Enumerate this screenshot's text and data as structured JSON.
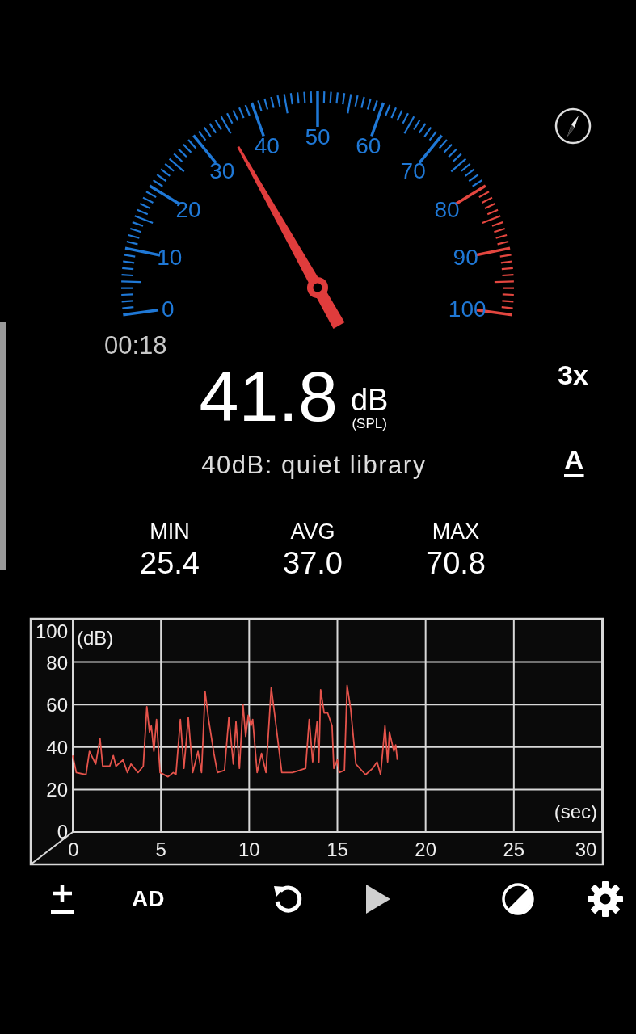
{
  "gauge": {
    "scale_labels": [
      "0",
      "10",
      "20",
      "30",
      "40",
      "50",
      "60",
      "70",
      "80",
      "90",
      "100"
    ],
    "timer": "00:18"
  },
  "reading": {
    "value": "41.8",
    "unit": "dB",
    "unit_note": "(SPL)",
    "zoom": "3x",
    "description": "40dB: quiet library",
    "weighting": "A"
  },
  "stats": [
    {
      "label": "MIN",
      "value": "25.4"
    },
    {
      "label": "AVG",
      "value": "37.0"
    },
    {
      "label": "MAX",
      "value": "70.8"
    }
  ],
  "history": {
    "chart_data": {
      "type": "line",
      "grid": true,
      "xlabel": "(sec)",
      "ylabel": "(dB)",
      "xlim": [
        0,
        30
      ],
      "ylim": [
        0,
        100
      ],
      "xticks": [
        0,
        5,
        10,
        15,
        20,
        25,
        30
      ],
      "yticks": [
        0,
        20,
        40,
        60,
        80,
        100
      ],
      "x": [
        0,
        0.2,
        0.75,
        0.95,
        1.3,
        1.55,
        1.7,
        2.1,
        2.3,
        2.45,
        2.85,
        3.1,
        3.3,
        3.7,
        4.0,
        4.2,
        4.35,
        4.45,
        4.6,
        4.75,
        4.95,
        5.4,
        5.7,
        5.85,
        6.1,
        6.3,
        6.55,
        6.8,
        7.1,
        7.3,
        7.5,
        7.7,
        8.0,
        8.2,
        8.6,
        8.85,
        9.1,
        9.25,
        9.45,
        9.65,
        9.8,
        9.95,
        10.1,
        10.2,
        10.45,
        10.7,
        10.95,
        11.25,
        11.45,
        11.85,
        12.45,
        12.85,
        13.2,
        13.4,
        13.6,
        13.85,
        13.95,
        14.05,
        14.25,
        14.45,
        14.7,
        14.8,
        15.0,
        15.1,
        15.4,
        15.55,
        15.75,
        16.05,
        16.6,
        17.0,
        17.25,
        17.45,
        17.7,
        17.85,
        17.95,
        18.2,
        18.3,
        18.4
      ],
      "series": [
        {
          "color": "#e5534b",
          "values": [
            36,
            28,
            27,
            38,
            32,
            44,
            31,
            31,
            36,
            31,
            34,
            28,
            32,
            28,
            31,
            59,
            47,
            50,
            38,
            53,
            28,
            26,
            28,
            27,
            53,
            30,
            54,
            28,
            38,
            28,
            66,
            53,
            37,
            28,
            29,
            54,
            32,
            52,
            30,
            60,
            45,
            55,
            50,
            53,
            28,
            37,
            28,
            68,
            55,
            28,
            28,
            29,
            30,
            53,
            33,
            52,
            33,
            67,
            56,
            56,
            50,
            30,
            34,
            28,
            29,
            69,
            58,
            32,
            27,
            30,
            33,
            27,
            50,
            33,
            47,
            38,
            41,
            34
          ]
        }
      ]
    }
  },
  "toolbar": {
    "ad_label": "AD"
  }
}
